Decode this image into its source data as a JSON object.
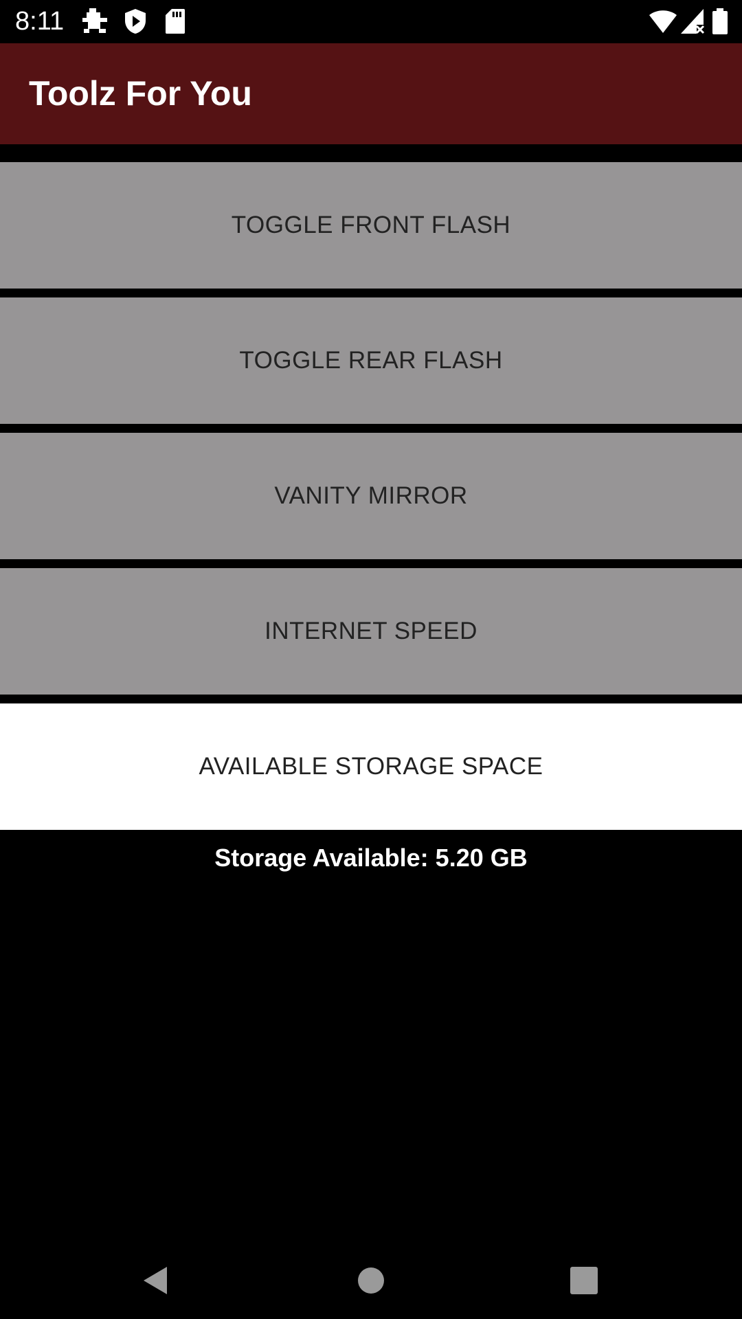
{
  "status_bar": {
    "time": "8:11",
    "left_icons": [
      "debug-bug-icon",
      "shield-play-icon",
      "sd-card-icon"
    ],
    "right_icons": [
      "wifi-icon",
      "cell-signal-no-data-icon",
      "battery-full-icon"
    ]
  },
  "app_bar": {
    "title": "Toolz For You",
    "color": "#551214"
  },
  "buttons": [
    {
      "label": "TOGGLE FRONT FLASH"
    },
    {
      "label": "TOGGLE REAR FLASH"
    },
    {
      "label": "VANITY MIRROR"
    },
    {
      "label": "INTERNET SPEED"
    },
    {
      "label": "AVAILABLE STORAGE SPACE",
      "active": true
    }
  ],
  "storage_result": "Storage Available: 5.20 GB",
  "nav_bar": {
    "icons": [
      "back-icon",
      "home-icon",
      "recents-icon"
    ]
  },
  "colors": {
    "button_background": "#979596",
    "active_button_background": "#ffffff",
    "page_background": "#000000"
  }
}
